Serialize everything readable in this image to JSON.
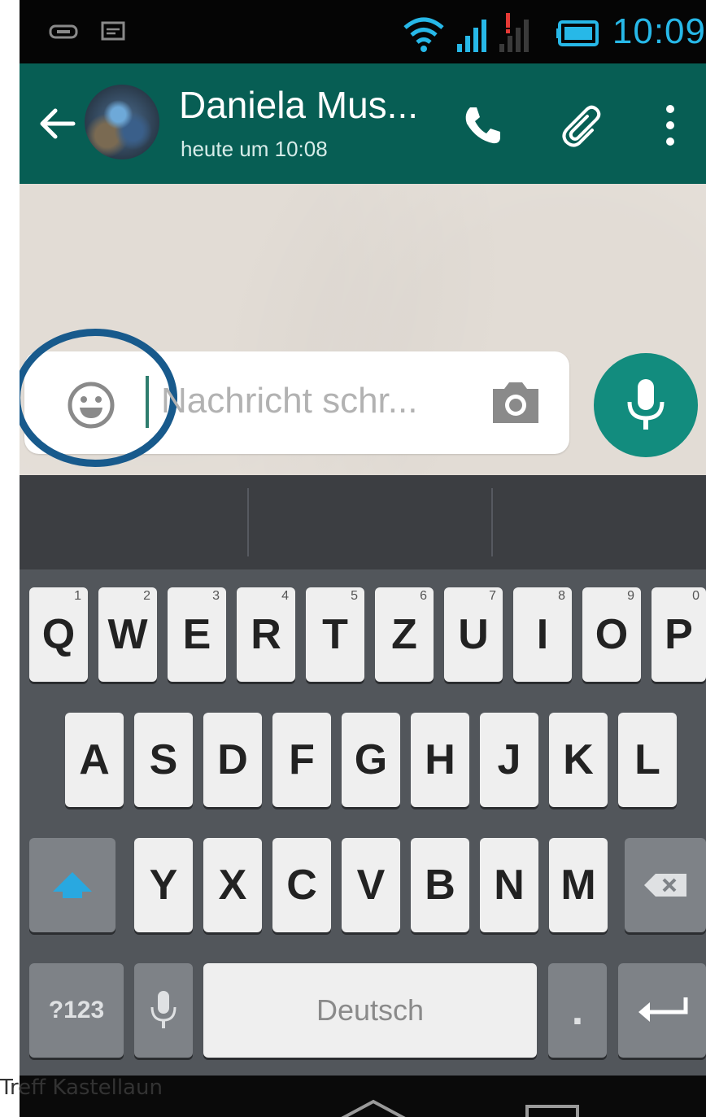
{
  "colors": {
    "appbar": "#075e54",
    "accent": "#128c7e",
    "clock": "#27b8e8",
    "highlight_ring": "#185a8c",
    "shift_arrow": "#29a8e0"
  },
  "status_bar": {
    "time": "10:09",
    "icons": [
      "mobile-data-icon",
      "message-icon",
      "wifi-icon",
      "signal-icon",
      "signal-no-sim-icon",
      "battery-icon"
    ]
  },
  "header": {
    "contact_name": "Daniela Mus...",
    "last_seen": "heute um 10:08",
    "icons": [
      "back-arrow-icon",
      "avatar",
      "phone-icon",
      "paperclip-icon",
      "more-vert-icon"
    ]
  },
  "composer": {
    "placeholder": "Nachricht schr...",
    "icons": [
      "smiley-icon",
      "camera-icon",
      "microphone-icon"
    ]
  },
  "keyboard": {
    "row1": [
      {
        "key": "Q",
        "hint": "1"
      },
      {
        "key": "W",
        "hint": "2"
      },
      {
        "key": "E",
        "hint": "3"
      },
      {
        "key": "R",
        "hint": "4"
      },
      {
        "key": "T",
        "hint": "5"
      },
      {
        "key": "Z",
        "hint": "6"
      },
      {
        "key": "U",
        "hint": "7"
      },
      {
        "key": "I",
        "hint": "8"
      },
      {
        "key": "O",
        "hint": "9"
      },
      {
        "key": "P",
        "hint": "0"
      }
    ],
    "row2": [
      "A",
      "S",
      "D",
      "F",
      "G",
      "H",
      "J",
      "K",
      "L"
    ],
    "row3": [
      "Y",
      "X",
      "C",
      "V",
      "B",
      "N",
      "M"
    ],
    "symbols_key": "?123",
    "space_label": "Deutsch",
    "period_key": "."
  },
  "watermark": "Treff Kastellaun"
}
